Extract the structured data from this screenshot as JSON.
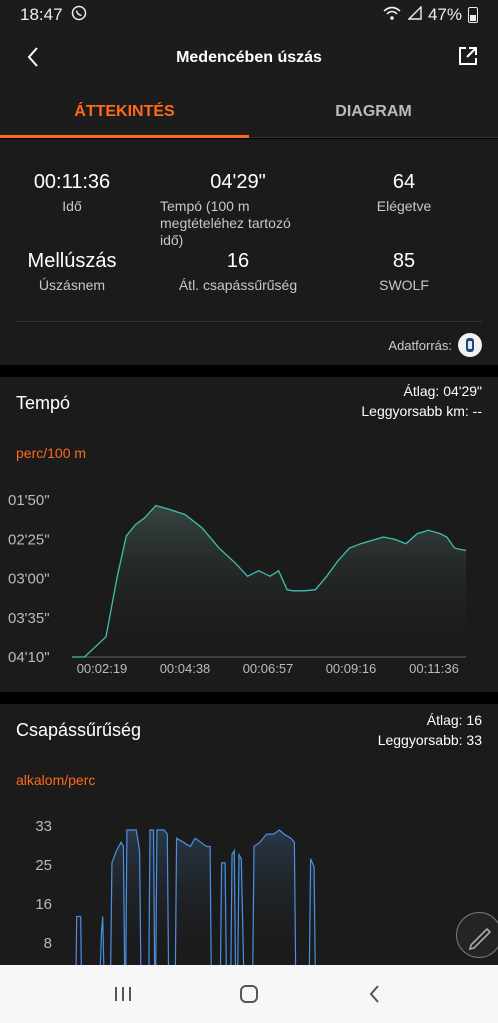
{
  "status": {
    "time": "18:47",
    "battery": "47%"
  },
  "header": {
    "title": "Medencében úszás"
  },
  "tabs": [
    {
      "label": "ÁTTEKINTÉS",
      "active": true
    },
    {
      "label": "DIAGRAM",
      "active": false
    }
  ],
  "summary": {
    "stats": [
      {
        "value": "00:11:36",
        "label": "Idő"
      },
      {
        "value": "04'29\"",
        "label": "Tempó (100 m megtételéhez tartozó idő)"
      },
      {
        "value": "64",
        "label": "Elégetve"
      },
      {
        "value": "Mellúszás",
        "label": "Úszásnem"
      },
      {
        "value": "16",
        "label": "Átl. csapássűrűség"
      },
      {
        "value": "85",
        "label": "SWOLF"
      }
    ],
    "source_label": "Adatforrás:"
  },
  "pace_card": {
    "title": "Tempó",
    "avg": "Átlag: 04'29\"",
    "fastest": "Leggyorsabb km: --",
    "unit": "perc/100 m"
  },
  "stroke_card": {
    "title": "Csapássűrűség",
    "avg": "Átlag: 16",
    "fastest": "Leggyorsabb: 33",
    "unit": "alkalom/perc"
  },
  "accent_color": "#ff6a1a",
  "chart_data": [
    {
      "type": "area",
      "y_ticks": [
        "01'50\"",
        "02'25\"",
        "03'00\"",
        "03'35\"",
        "04'10\""
      ],
      "x_ticks": [
        "00:02:19",
        "00:04:38",
        "00:06:57",
        "00:09:16",
        "00:11:36"
      ],
      "ylim_seconds": [
        110,
        250
      ],
      "xlim_seconds": [
        0,
        696
      ],
      "color": "#3fbfb0",
      "points": [
        [
          0,
          250
        ],
        [
          22,
          250
        ],
        [
          60,
          232
        ],
        [
          80,
          178
        ],
        [
          96,
          142
        ],
        [
          112,
          132
        ],
        [
          128,
          126
        ],
        [
          148,
          115
        ],
        [
          170,
          118
        ],
        [
          200,
          123
        ],
        [
          230,
          135
        ],
        [
          260,
          153
        ],
        [
          290,
          167
        ],
        [
          310,
          178
        ],
        [
          330,
          173
        ],
        [
          350,
          178
        ],
        [
          365,
          173
        ],
        [
          380,
          190
        ],
        [
          390,
          191
        ],
        [
          410,
          191
        ],
        [
          430,
          190
        ],
        [
          450,
          178
        ],
        [
          470,
          164
        ],
        [
          490,
          153
        ],
        [
          510,
          149
        ],
        [
          530,
          146
        ],
        [
          550,
          143
        ],
        [
          570,
          145
        ],
        [
          590,
          149
        ],
        [
          610,
          140
        ],
        [
          630,
          137
        ],
        [
          650,
          140
        ],
        [
          662,
          143
        ],
        [
          676,
          153
        ],
        [
          696,
          155
        ]
      ]
    },
    {
      "type": "area",
      "y_ticks": [
        "33",
        "25",
        "16",
        "8"
      ],
      "ylim": [
        0,
        36
      ],
      "xlim_seconds": [
        0,
        696
      ],
      "color": "#4a90e2",
      "points": [
        [
          0,
          0
        ],
        [
          14,
          0
        ],
        [
          15,
          12
        ],
        [
          22,
          12
        ],
        [
          23,
          0
        ],
        [
          56,
          0
        ],
        [
          58,
          8
        ],
        [
          60,
          12
        ],
        [
          62,
          0
        ],
        [
          74,
          0
        ],
        [
          76,
          25
        ],
        [
          84,
          28
        ],
        [
          92,
          30
        ],
        [
          96,
          29
        ],
        [
          98,
          0
        ],
        [
          100,
          0
        ],
        [
          102,
          33
        ],
        [
          118,
          33
        ],
        [
          124,
          28
        ],
        [
          126,
          0
        ],
        [
          140,
          0
        ],
        [
          142,
          33
        ],
        [
          148,
          33
        ],
        [
          150,
          0
        ],
        [
          152,
          0
        ],
        [
          154,
          33
        ],
        [
          162,
          33
        ],
        [
          166,
          33
        ],
        [
          172,
          32
        ],
        [
          174,
          0
        ],
        [
          186,
          0
        ],
        [
          188,
          31
        ],
        [
          200,
          30
        ],
        [
          212,
          29
        ],
        [
          220,
          31
        ],
        [
          230,
          30
        ],
        [
          240,
          29
        ],
        [
          246,
          29
        ],
        [
          248,
          0
        ],
        [
          264,
          0
        ],
        [
          266,
          25
        ],
        [
          272,
          25
        ],
        [
          274,
          0
        ],
        [
          282,
          0
        ],
        [
          284,
          27
        ],
        [
          288,
          28
        ],
        [
          290,
          0
        ],
        [
          294,
          0
        ],
        [
          296,
          27
        ],
        [
          300,
          26
        ],
        [
          304,
          0
        ],
        [
          320,
          0
        ],
        [
          322,
          29
        ],
        [
          332,
          30
        ],
        [
          344,
          32
        ],
        [
          356,
          32
        ],
        [
          366,
          33
        ],
        [
          374,
          32
        ],
        [
          386,
          31
        ],
        [
          392,
          30
        ],
        [
          394,
          0
        ],
        [
          418,
          0
        ],
        [
          420,
          26
        ],
        [
          426,
          24
        ],
        [
          428,
          0
        ],
        [
          696,
          0
        ]
      ]
    }
  ]
}
